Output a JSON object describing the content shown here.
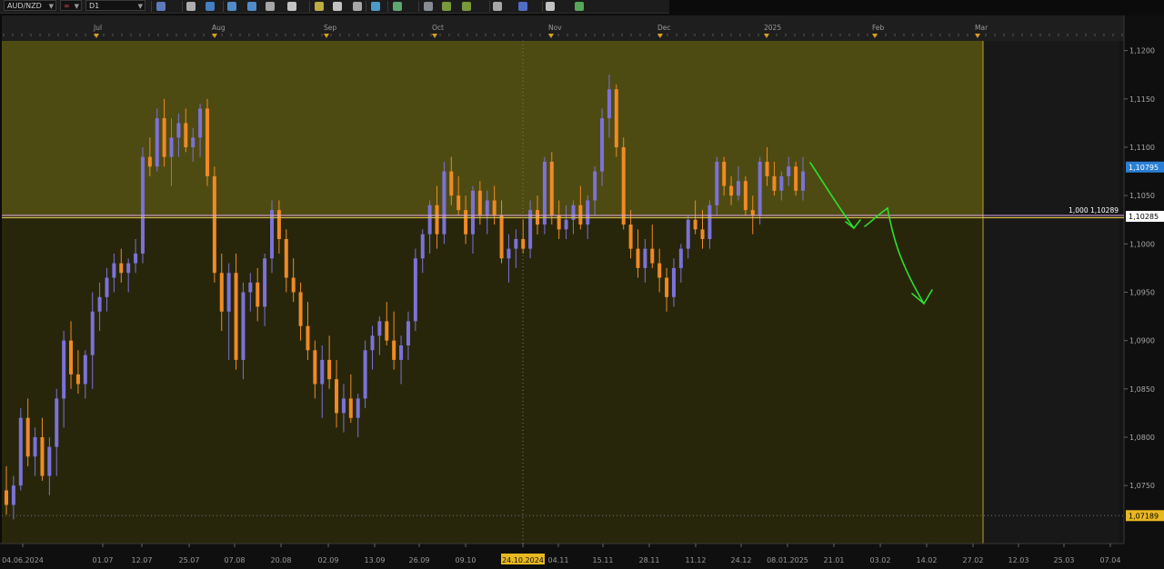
{
  "toolbar": {
    "symbol": "AUD/NZD",
    "timeframe": "D1",
    "icons": [
      "chart-type-icon",
      "crosshair-icon",
      "line-tool-icon",
      "zoom-in-icon",
      "zoom-out-icon",
      "scroll-icon",
      "cursor-icon",
      "trendline-icon",
      "template-icon",
      "screenshot-icon",
      "indicators-icon",
      "objects-icon",
      "pencil-icon",
      "shapes-icon",
      "fibonacci-icon",
      "text-icon",
      "arrow-icon",
      "eraser-icon",
      "more-icon"
    ]
  },
  "colors": {
    "bull": "#7b72d8",
    "bear": "#f08a24",
    "zone_upper": "#4e4b12",
    "zone_lower": "#27260b",
    "future_area": "#181818",
    "level_line": "#d8b94a",
    "forecast_arrow": "#2ee02e",
    "price_box_current": "#2a7fd4",
    "price_box_level": "#ffffff",
    "price_box_low": "#e8b820"
  },
  "chart_data": {
    "type": "candlestick",
    "symbol": "AUD/NZD",
    "timeframe": "D1",
    "yrange": [
      1.069,
      1.121
    ],
    "y_ticks": [
      "1,1200",
      "1,1150",
      "1,1100",
      "1,1050",
      "1,1000",
      "1,0950",
      "1,0900",
      "1,0850",
      "1,0800",
      "1,0750"
    ],
    "y_tick_values": [
      1.12,
      1.115,
      1.11,
      1.105,
      1.1,
      1.095,
      1.09,
      1.085,
      1.08,
      1.075
    ],
    "month_labels": [
      "Jul",
      "Aug",
      "Sep",
      "Oct",
      "Nov",
      "Dec",
      "2025",
      "Feb",
      "Mar"
    ],
    "date_labels": [
      "04.06.2024",
      "01.07",
      "12.07",
      "25.07",
      "07.08",
      "20.08",
      "02.09",
      "13.09",
      "26.09",
      "09.10",
      "24.10.2024",
      "04.11",
      "15.11",
      "28.11",
      "11.12",
      "24.12",
      "08.01.2025",
      "21.01",
      "03.02",
      "14.02",
      "27.02",
      "12.03",
      "25.03",
      "07.04"
    ],
    "price_labels": {
      "current": "1,10795",
      "level": "1,10285",
      "low": "1,07189",
      "level_annotation": "1,000 1,10289"
    },
    "levels": {
      "current": 1.10795,
      "level": 1.10285,
      "low": 1.07189
    },
    "candles": [
      [
        1.0745,
        1.077,
        1.072,
        1.073
      ],
      [
        1.073,
        1.076,
        1.0715,
        1.075
      ],
      [
        1.075,
        1.083,
        1.0745,
        1.082
      ],
      [
        1.082,
        1.084,
        1.077,
        1.078
      ],
      [
        1.078,
        1.081,
        1.076,
        1.08
      ],
      [
        1.08,
        1.082,
        1.0755,
        1.076
      ],
      [
        1.076,
        1.08,
        1.074,
        1.079
      ],
      [
        1.079,
        1.085,
        1.076,
        1.084
      ],
      [
        1.084,
        1.091,
        1.081,
        1.09
      ],
      [
        1.09,
        1.092,
        1.085,
        1.0865
      ],
      [
        1.0865,
        1.089,
        1.0845,
        1.0855
      ],
      [
        1.0855,
        1.089,
        1.084,
        1.0885
      ],
      [
        1.0885,
        1.095,
        1.085,
        1.093
      ],
      [
        1.093,
        1.096,
        1.091,
        1.0945
      ],
      [
        1.0945,
        1.0975,
        1.093,
        1.0965
      ],
      [
        1.0965,
        1.099,
        1.095,
        1.098
      ],
      [
        1.098,
        1.0995,
        1.096,
        1.097
      ],
      [
        1.097,
        1.0985,
        1.095,
        1.098
      ],
      [
        1.098,
        1.1005,
        1.097,
        1.099
      ],
      [
        1.099,
        1.11,
        1.098,
        1.109
      ],
      [
        1.109,
        1.111,
        1.107,
        1.108
      ],
      [
        1.108,
        1.114,
        1.1075,
        1.113
      ],
      [
        1.113,
        1.115,
        1.108,
        1.109
      ],
      [
        1.109,
        1.113,
        1.106,
        1.111
      ],
      [
        1.111,
        1.1135,
        1.109,
        1.1125
      ],
      [
        1.1125,
        1.114,
        1.1095,
        1.11
      ],
      [
        1.11,
        1.112,
        1.1085,
        1.111
      ],
      [
        1.111,
        1.1145,
        1.109,
        1.114
      ],
      [
        1.114,
        1.115,
        1.106,
        1.107
      ],
      [
        1.107,
        1.108,
        1.096,
        1.097
      ],
      [
        1.097,
        1.099,
        1.091,
        1.093
      ],
      [
        1.093,
        1.098,
        1.088,
        1.097
      ],
      [
        1.097,
        1.099,
        1.087,
        1.088
      ],
      [
        1.088,
        1.096,
        1.086,
        1.095
      ],
      [
        1.095,
        1.097,
        1.093,
        1.096
      ],
      [
        1.096,
        1.0975,
        1.092,
        1.0935
      ],
      [
        1.0935,
        1.099,
        1.0915,
        1.0985
      ],
      [
        1.0985,
        1.1045,
        1.097,
        1.1035
      ],
      [
        1.1035,
        1.1045,
        1.099,
        1.1005
      ],
      [
        1.1005,
        1.1015,
        1.095,
        1.0965
      ],
      [
        1.0965,
        1.0985,
        1.094,
        1.095
      ],
      [
        1.095,
        1.096,
        1.09,
        1.0915
      ],
      [
        1.0915,
        1.094,
        1.088,
        1.089
      ],
      [
        1.089,
        1.09,
        1.084,
        1.0855
      ],
      [
        1.0855,
        1.0895,
        1.082,
        1.088
      ],
      [
        1.088,
        1.0905,
        1.085,
        1.086
      ],
      [
        1.086,
        1.088,
        1.081,
        1.0825
      ],
      [
        1.0825,
        1.0855,
        1.0805,
        1.084
      ],
      [
        1.084,
        1.0865,
        1.0815,
        1.082
      ],
      [
        1.082,
        1.0845,
        1.08,
        1.084
      ],
      [
        1.084,
        1.09,
        1.083,
        1.089
      ],
      [
        1.089,
        1.0915,
        1.087,
        1.0905
      ],
      [
        1.0905,
        1.0925,
        1.0885,
        1.092
      ],
      [
        1.092,
        1.094,
        1.0895,
        1.09
      ],
      [
        1.09,
        1.093,
        1.087,
        1.088
      ],
      [
        1.088,
        1.0905,
        1.0855,
        1.0895
      ],
      [
        1.0895,
        1.093,
        1.088,
        1.092
      ],
      [
        1.092,
        1.0995,
        1.091,
        1.0985
      ],
      [
        1.0985,
        1.1015,
        1.097,
        1.101
      ],
      [
        1.101,
        1.1045,
        1.099,
        1.104
      ],
      [
        1.104,
        1.106,
        1.0995,
        1.101
      ],
      [
        1.101,
        1.1085,
        1.1,
        1.1075
      ],
      [
        1.1075,
        1.109,
        1.104,
        1.105
      ],
      [
        1.105,
        1.107,
        1.103,
        1.1035
      ],
      [
        1.1035,
        1.105,
        1.1,
        1.101
      ],
      [
        1.101,
        1.106,
        1.099,
        1.1055
      ],
      [
        1.1055,
        1.1065,
        1.102,
        1.103
      ],
      [
        1.103,
        1.1055,
        1.101,
        1.1045
      ],
      [
        1.1045,
        1.106,
        1.102,
        1.103
      ],
      [
        1.103,
        1.1045,
        1.098,
        1.0985
      ],
      [
        1.0985,
        1.101,
        1.096,
        1.0995
      ],
      [
        1.0995,
        1.1015,
        1.0975,
        1.1005
      ],
      [
        1.1005,
        1.1025,
        1.099,
        1.0995
      ],
      [
        1.0995,
        1.1045,
        1.0985,
        1.1035
      ],
      [
        1.1035,
        1.105,
        1.101,
        1.102
      ],
      [
        1.102,
        1.109,
        1.101,
        1.1085
      ],
      [
        1.1085,
        1.1095,
        1.102,
        1.103
      ],
      [
        1.103,
        1.1045,
        1.1005,
        1.1015
      ],
      [
        1.1015,
        1.104,
        1.1005,
        1.1025
      ],
      [
        1.1025,
        1.1045,
        1.101,
        1.104
      ],
      [
        1.104,
        1.106,
        1.1015,
        1.102
      ],
      [
        1.102,
        1.105,
        1.1005,
        1.1045
      ],
      [
        1.1045,
        1.108,
        1.103,
        1.1075
      ],
      [
        1.1075,
        1.114,
        1.106,
        1.113
      ],
      [
        1.113,
        1.1175,
        1.111,
        1.116
      ],
      [
        1.116,
        1.1165,
        1.109,
        1.11
      ],
      [
        1.11,
        1.111,
        1.1015,
        1.102
      ],
      [
        1.102,
        1.1035,
        1.0985,
        1.0995
      ],
      [
        1.0995,
        1.1015,
        1.0965,
        1.0975
      ],
      [
        1.0975,
        1.1005,
        1.096,
        1.0995
      ],
      [
        1.0995,
        1.102,
        1.0975,
        1.098
      ],
      [
        1.098,
        1.0995,
        1.095,
        1.0965
      ],
      [
        1.0965,
        1.0975,
        1.093,
        1.0945
      ],
      [
        1.0945,
        1.0985,
        1.0935,
        1.0975
      ],
      [
        1.0975,
        1.1,
        1.096,
        1.0995
      ],
      [
        1.0995,
        1.103,
        1.0985,
        1.1025
      ],
      [
        1.1025,
        1.1045,
        1.101,
        1.1015
      ],
      [
        1.1015,
        1.1035,
        1.0995,
        1.1005
      ],
      [
        1.1005,
        1.1045,
        1.0995,
        1.104
      ],
      [
        1.104,
        1.109,
        1.103,
        1.1085
      ],
      [
        1.1085,
        1.109,
        1.105,
        1.106
      ],
      [
        1.106,
        1.107,
        1.104,
        1.105
      ],
      [
        1.105,
        1.108,
        1.1045,
        1.1065
      ],
      [
        1.1065,
        1.107,
        1.103,
        1.1035
      ],
      [
        1.1035,
        1.105,
        1.101,
        1.103
      ],
      [
        1.103,
        1.109,
        1.102,
        1.1085
      ],
      [
        1.1085,
        1.11,
        1.106,
        1.107
      ],
      [
        1.107,
        1.1085,
        1.105,
        1.1055
      ],
      [
        1.1055,
        1.1075,
        1.1045,
        1.107
      ],
      [
        1.107,
        1.109,
        1.106,
        1.108
      ],
      [
        1.108,
        1.1085,
        1.105,
        1.1055
      ],
      [
        1.1055,
        1.109,
        1.1045,
        1.1075
      ]
    ]
  }
}
